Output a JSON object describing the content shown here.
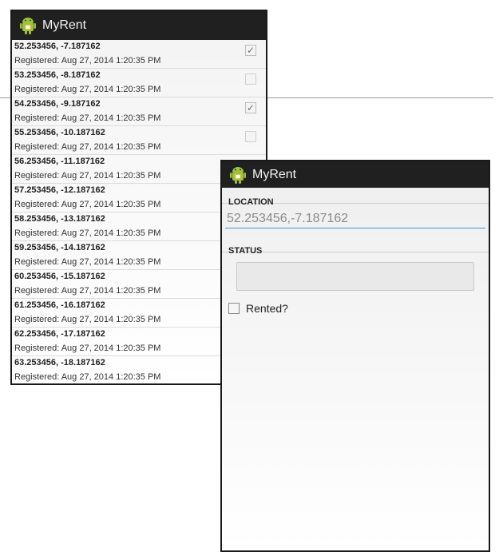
{
  "list_screen": {
    "app_title": "MyRent",
    "app_icon": "android-icon",
    "rows": [
      {
        "coords": "52.253456, -7.187162",
        "registered": "Registered: Aug 27, 2014 1:20:35 PM",
        "rented": true
      },
      {
        "coords": "53.253456, -8.187162",
        "registered": "Registered: Aug 27, 2014 1:20:35 PM",
        "rented": false
      },
      {
        "coords": "54.253456, -9.187162",
        "registered": "Registered: Aug 27, 2014 1:20:35 PM",
        "rented": true
      },
      {
        "coords": "55.253456, -10.187162",
        "registered": "Registered: Aug 27, 2014 1:20:35 PM",
        "rented": false
      },
      {
        "coords": "56.253456, -11.187162",
        "registered": "Registered: Aug 27, 2014 1:20:35 PM",
        "rented": false
      },
      {
        "coords": "57.253456, -12.187162",
        "registered": "Registered: Aug 27, 2014 1:20:35 PM",
        "rented": false
      },
      {
        "coords": "58.253456, -13.187162",
        "registered": "Registered: Aug 27, 2014 1:20:35 PM",
        "rented": false
      },
      {
        "coords": "59.253456, -14.187162",
        "registered": "Registered: Aug 27, 2014 1:20:35 PM",
        "rented": false
      },
      {
        "coords": "60.253456, -15.187162",
        "registered": "Registered: Aug 27, 2014 1:20:35 PM",
        "rented": false
      },
      {
        "coords": "61.253456, -16.187162",
        "registered": "Registered: Aug 27, 2014 1:20:35 PM",
        "rented": false
      },
      {
        "coords": "62.253456, -17.187162",
        "registered": "Registered: Aug 27, 2014 1:20:35 PM",
        "rented": false
      },
      {
        "coords": "63.253456, -18.187162",
        "registered": "Registered: Aug 27, 2014 1:20:35 PM",
        "rented": false
      }
    ]
  },
  "detail_screen": {
    "app_title": "MyRent",
    "app_icon": "android-icon",
    "location_header": "LOCATION",
    "location_value": "52.253456,-7.187162",
    "status_header": "STATUS",
    "status_value": "",
    "rented_label": "Rented?",
    "rented_checked": false
  },
  "colors": {
    "action_bar": "#202020",
    "input_underline": "#3aa0d8",
    "android_green": "#9bc33c"
  }
}
